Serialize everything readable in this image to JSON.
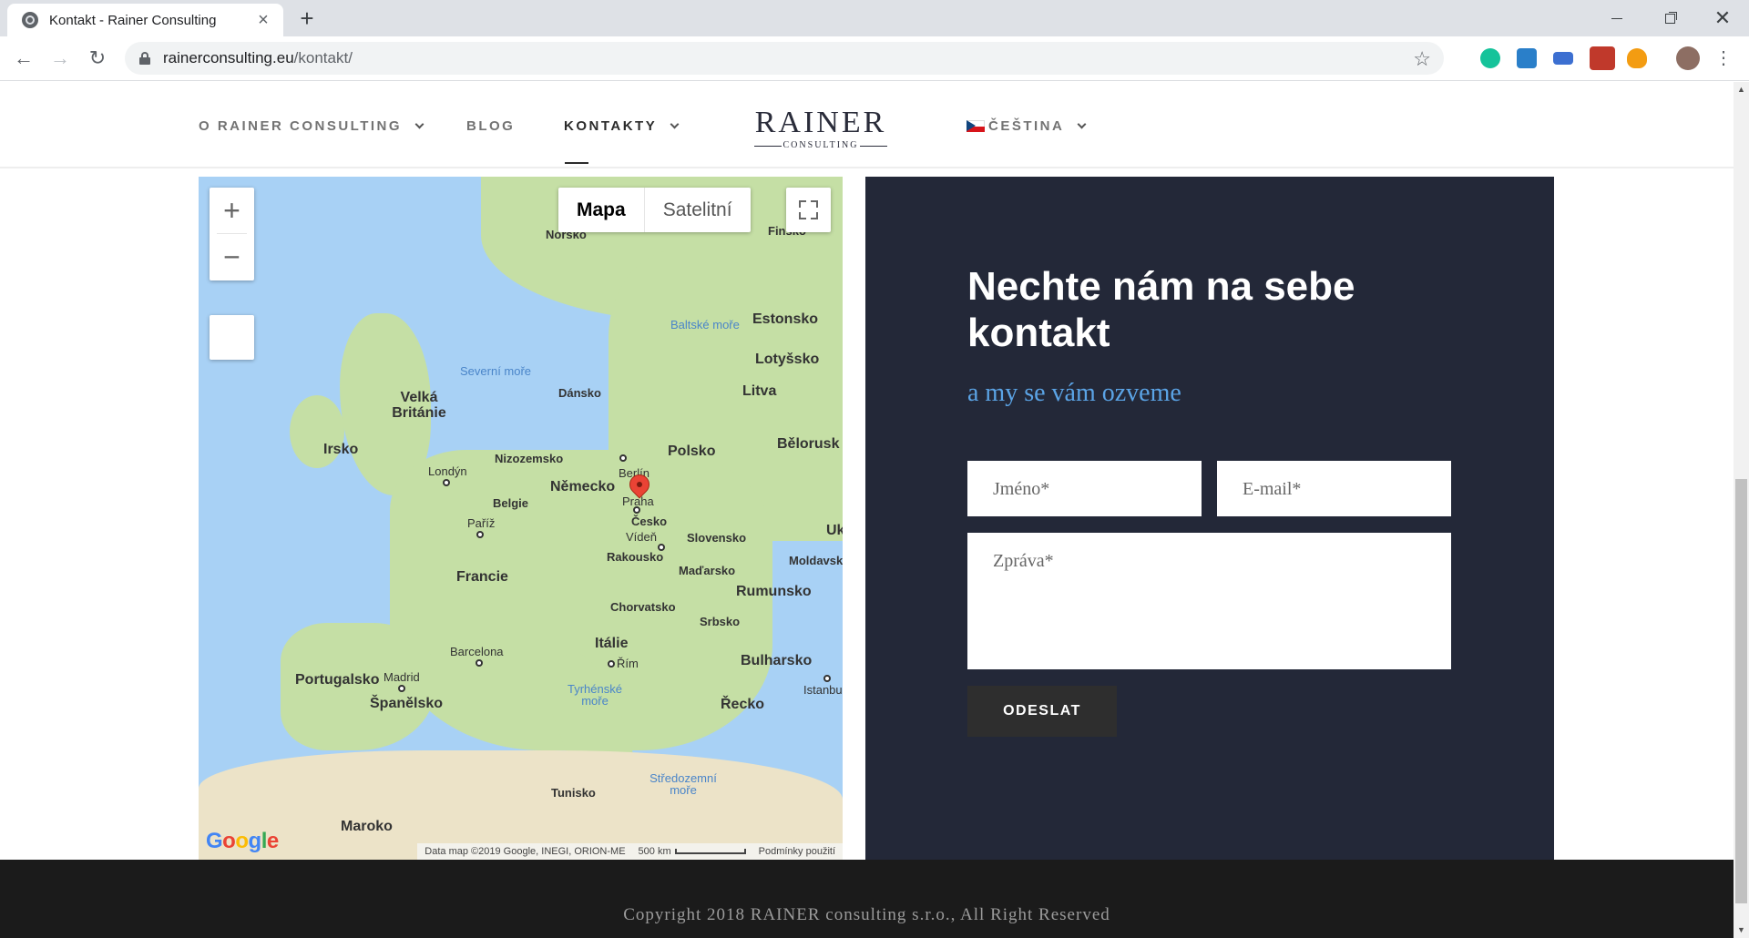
{
  "browser": {
    "tab_title": "Kontakt - Rainer Consulting",
    "url_host": "rainerconsulting.eu",
    "url_path": "/kontakt/"
  },
  "nav": {
    "items": [
      {
        "label": "O RAINER CONSULTING"
      },
      {
        "label": "BLOG"
      },
      {
        "label": "KONTAKTY"
      }
    ],
    "language": "ČEŠTINA",
    "logo_main": "RAINER",
    "logo_sub": "CONSULTING"
  },
  "map": {
    "type_map": "Mapa",
    "type_satellite": "Satelitní",
    "footer_data": "Data map ©2019 Google, INEGI, ORION-ME",
    "footer_scale": "500 km",
    "footer_terms": "Podmínky použití",
    "google": "Google",
    "labels": {
      "norsko": "Norsko",
      "finsko": "Finsko",
      "baltske": "Baltské moře",
      "estonsko": "Estonsko",
      "lotyssko": "Lotyšsko",
      "severni": "Severní moře",
      "dansko": "Dánsko",
      "litva": "Litva",
      "velka": "Velká Británie",
      "irsko": "Irsko",
      "nizozemsko": "Nizozemsko",
      "berlin": "Berlín",
      "polsko": "Polsko",
      "belorusko": "Bělorusk",
      "londyn": "Londýn",
      "nemecko": "Německo",
      "belgie": "Belgie",
      "praha": "Praha",
      "cesko": "Česko",
      "pariz": "Paříž",
      "viden": "Vídeň",
      "slovensko": "Slovensko",
      "uk": "Uk",
      "rakousko": "Rakousko",
      "moldavsko": "Moldavsk",
      "francie": "Francie",
      "madarsko": "Maďarsko",
      "rumunsko": "Rumunsko",
      "chorvatsko": "Chorvatsko",
      "srbsko": "Srbsko",
      "italie": "Itálie",
      "barcelona": "Barcelona",
      "rim": "Řím",
      "bulharsko": "Bulharsko",
      "portugalsko": "Portugalsko",
      "madrid": "Madrid",
      "spanelsko": "Španělsko",
      "tyrhenske": "Tyrhénské moře",
      "istanbu": "Istanbu",
      "recko": "Řecko",
      "stredozemni": "Středozemní moře",
      "tunisko": "Tunisko",
      "maroko": "Maroko"
    }
  },
  "contact": {
    "title": "Nechte nám na sebe kontakt",
    "subtitle": "a my se vám ozveme",
    "name_placeholder": "Jméno*",
    "email_placeholder": "E-mail*",
    "message_placeholder": "Zpráva*",
    "submit_label": "ODESLAT"
  },
  "footer": {
    "copyright": "Copyright 2018 RAINER consulting s.r.o., All Right Reserved"
  }
}
